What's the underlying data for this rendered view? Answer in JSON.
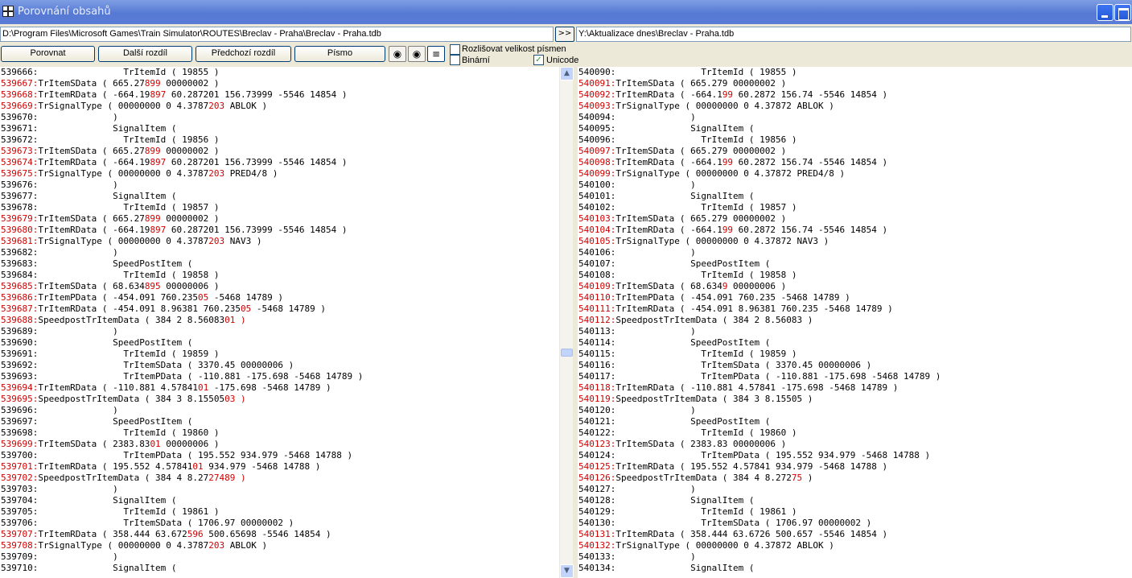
{
  "window": {
    "title": "Porovnání obsahů"
  },
  "paths": {
    "left": "D:\\Program Files\\Microsoft Games\\Train Simulator\\ROUTES\\Breclav - Praha\\Breclav - Praha.tdb",
    "right": "Y:\\Aktualizace dnes\\Breclav - Praha.tdb",
    "swap_label": ">>"
  },
  "toolbar": {
    "compare": "Porovnat",
    "next_diff": "Další rozdíl",
    "prev_diff": "Předchozí rozdíl",
    "font": "Písmo",
    "case_sensitive": {
      "label": "Rozlišovat velikost písmen",
      "checked": false
    },
    "binary": {
      "label": "Binární",
      "checked": false
    },
    "unicode": {
      "label": "Unicode",
      "checked": true
    }
  },
  "left_lines": [
    {
      "n": "539666:",
      "pre": "                TrItemId ( 19855 )",
      "d": "",
      "post": ""
    },
    {
      "n": "539667:",
      "dn": true,
      "pre": "TrItemSData ( 665.27",
      "d": "899",
      "post": " 00000002 )"
    },
    {
      "n": "539668:",
      "dn": true,
      "pre": "TrItemRData ( -664.19",
      "d": "897",
      "post": " 60.287201 156.73999 -5546 14854 )"
    },
    {
      "n": "539669:",
      "dn": true,
      "pre": "TrSignalType ( 00000000 0 4.3787",
      "d": "203",
      "post": " ABLOK )"
    },
    {
      "n": "539670:",
      "pre": "              )",
      "d": "",
      "post": ""
    },
    {
      "n": "539671:",
      "pre": "              SignalItem (",
      "d": "",
      "post": ""
    },
    {
      "n": "539672:",
      "pre": "                TrItemId ( 19856 )",
      "d": "",
      "post": ""
    },
    {
      "n": "539673:",
      "dn": true,
      "pre": "TrItemSData ( 665.27",
      "d": "899",
      "post": " 00000002 )"
    },
    {
      "n": "539674:",
      "dn": true,
      "pre": "TrItemRData ( -664.19",
      "d": "897",
      "post": " 60.287201 156.73999 -5546 14854 )"
    },
    {
      "n": "539675:",
      "dn": true,
      "pre": "TrSignalType ( 00000000 0 4.3787",
      "d": "203",
      "post": " PRED4/8 )"
    },
    {
      "n": "539676:",
      "pre": "              )",
      "d": "",
      "post": ""
    },
    {
      "n": "539677:",
      "pre": "              SignalItem (",
      "d": "",
      "post": ""
    },
    {
      "n": "539678:",
      "pre": "                TrItemId ( 19857 )",
      "d": "",
      "post": ""
    },
    {
      "n": "539679:",
      "dn": true,
      "pre": "TrItemSData ( 665.27",
      "d": "899",
      "post": " 00000002 )"
    },
    {
      "n": "539680:",
      "dn": true,
      "pre": "TrItemRData ( -664.19",
      "d": "897",
      "post": " 60.287201 156.73999 -5546 14854 )"
    },
    {
      "n": "539681:",
      "dn": true,
      "pre": "TrSignalType ( 00000000 0 4.3787",
      "d": "203",
      "post": " NAV3 )"
    },
    {
      "n": "539682:",
      "pre": "              )",
      "d": "",
      "post": ""
    },
    {
      "n": "539683:",
      "pre": "              SpeedPostItem (",
      "d": "",
      "post": ""
    },
    {
      "n": "539684:",
      "pre": "                TrItemId ( 19858 )",
      "d": "",
      "post": ""
    },
    {
      "n": "539685:",
      "dn": true,
      "pre": "TrItemSData ( 68.634",
      "d": "895",
      "post": " 00000006 )"
    },
    {
      "n": "539686:",
      "dn": true,
      "pre": "TrItemPData ( -454.091 760.235",
      "d": "05",
      "post": " -5468 14789 )"
    },
    {
      "n": "539687:",
      "dn": true,
      "pre": "TrItemRData ( -454.091 8.96381 760.235",
      "d": "05",
      "post": " -5468 14789 )"
    },
    {
      "n": "539688:",
      "dn": true,
      "pre": "SpeedpostTrItemData ( 384 2 8.56083",
      "d": "01 )",
      "post": ""
    },
    {
      "n": "539689:",
      "pre": "              )",
      "d": "",
      "post": ""
    },
    {
      "n": "539690:",
      "pre": "              SpeedPostItem (",
      "d": "",
      "post": ""
    },
    {
      "n": "539691:",
      "pre": "                TrItemId ( 19859 )",
      "d": "",
      "post": ""
    },
    {
      "n": "539692:",
      "pre": "                TrItemSData ( 3370.45 00000006 )",
      "d": "",
      "post": ""
    },
    {
      "n": "539693:",
      "pre": "                TrItemPData ( -110.881 -175.698 -5468 14789 )",
      "d": "",
      "post": ""
    },
    {
      "n": "539694:",
      "dn": true,
      "pre": "TrItemRData ( -110.881 4.57841",
      "d": "01",
      "post": " -175.698 -5468 14789 )"
    },
    {
      "n": "539695:",
      "dn": true,
      "pre": "SpeedpostTrItemData ( 384 3 8.15505",
      "d": "03 )",
      "post": ""
    },
    {
      "n": "539696:",
      "pre": "              )",
      "d": "",
      "post": ""
    },
    {
      "n": "539697:",
      "pre": "              SpeedPostItem (",
      "d": "",
      "post": ""
    },
    {
      "n": "539698:",
      "pre": "                TrItemId ( 19860 )",
      "d": "",
      "post": ""
    },
    {
      "n": "539699:",
      "dn": true,
      "pre": "TrItemSData ( 2383.83",
      "d": "01",
      "post": " 00000006 )"
    },
    {
      "n": "539700:",
      "pre": "                TrItemPData ( 195.552 934.979 -5468 14788 )",
      "d": "",
      "post": ""
    },
    {
      "n": "539701:",
      "dn": true,
      "pre": "TrItemRData ( 195.552 4.57841",
      "d": "01",
      "post": " 934.979 -5468 14788 )"
    },
    {
      "n": "539702:",
      "dn": true,
      "pre": "SpeedpostTrItemData ( 384 4 8.27",
      "d": "27489 )",
      "post": ""
    },
    {
      "n": "539703:",
      "pre": "              )",
      "d": "",
      "post": ""
    },
    {
      "n": "539704:",
      "pre": "              SignalItem (",
      "d": "",
      "post": ""
    },
    {
      "n": "539705:",
      "pre": "                TrItemId ( 19861 )",
      "d": "",
      "post": ""
    },
    {
      "n": "539706:",
      "pre": "                TrItemSData ( 1706.97 00000002 )",
      "d": "",
      "post": ""
    },
    {
      "n": "539707:",
      "dn": true,
      "pre": "TrItemRData ( 358.444 63.672",
      "d": "596",
      "post": " 500.65698 -5546 14854 )"
    },
    {
      "n": "539708:",
      "dn": true,
      "pre": "TrSignalType ( 00000000 0 4.3787",
      "d": "203",
      "post": " ABLOK )"
    },
    {
      "n": "539709:",
      "pre": "              )",
      "d": "",
      "post": ""
    },
    {
      "n": "539710:",
      "pre": "              SignalItem (",
      "d": "",
      "post": ""
    }
  ],
  "right_lines": [
    {
      "n": "540090:",
      "pre": "                TrItemId ( 19855 )",
      "d": "",
      "post": ""
    },
    {
      "n": "540091:",
      "dn": true,
      "pre": "TrItemSData ( 665.279 00000002 )",
      "d": "",
      "post": ""
    },
    {
      "n": "540092:",
      "dn": true,
      "pre": "TrItemRData ( -664.1",
      "d": "99",
      "post": " 60.2872 156.74 -5546 14854 )"
    },
    {
      "n": "540093:",
      "dn": true,
      "pre": "TrSignalType ( 00000000 0 4.37872 ABLOK )",
      "d": "",
      "post": ""
    },
    {
      "n": "540094:",
      "pre": "              )",
      "d": "",
      "post": ""
    },
    {
      "n": "540095:",
      "pre": "              SignalItem (",
      "d": "",
      "post": ""
    },
    {
      "n": "540096:",
      "pre": "                TrItemId ( 19856 )",
      "d": "",
      "post": ""
    },
    {
      "n": "540097:",
      "dn": true,
      "pre": "TrItemSData ( 665.279 00000002 )",
      "d": "",
      "post": ""
    },
    {
      "n": "540098:",
      "dn": true,
      "pre": "TrItemRData ( -664.1",
      "d": "99",
      "post": " 60.2872 156.74 -5546 14854 )"
    },
    {
      "n": "540099:",
      "dn": true,
      "pre": "TrSignalType ( 00000000 0 4.37872 PRED4/8 )",
      "d": "",
      "post": ""
    },
    {
      "n": "540100:",
      "pre": "              )",
      "d": "",
      "post": ""
    },
    {
      "n": "540101:",
      "pre": "              SignalItem (",
      "d": "",
      "post": ""
    },
    {
      "n": "540102:",
      "pre": "                TrItemId ( 19857 )",
      "d": "",
      "post": ""
    },
    {
      "n": "540103:",
      "dn": true,
      "pre": "TrItemSData ( 665.279 00000002 )",
      "d": "",
      "post": ""
    },
    {
      "n": "540104:",
      "dn": true,
      "pre": "TrItemRData ( -664.1",
      "d": "99",
      "post": " 60.2872 156.74 -5546 14854 )"
    },
    {
      "n": "540105:",
      "dn": true,
      "pre": "TrSignalType ( 00000000 0 4.37872 NAV3 )",
      "d": "",
      "post": ""
    },
    {
      "n": "540106:",
      "pre": "              )",
      "d": "",
      "post": ""
    },
    {
      "n": "540107:",
      "pre": "              SpeedPostItem (",
      "d": "",
      "post": ""
    },
    {
      "n": "540108:",
      "pre": "                TrItemId ( 19858 )",
      "d": "",
      "post": ""
    },
    {
      "n": "540109:",
      "dn": true,
      "pre": "TrItemSData ( 68.634",
      "d": "9",
      "post": " 00000006 )"
    },
    {
      "n": "540110:",
      "dn": true,
      "pre": "TrItemPData ( -454.091 760.235 -5468 14789 )",
      "d": "",
      "post": ""
    },
    {
      "n": "540111:",
      "dn": true,
      "pre": "TrItemRData ( -454.091 8.96381 760.235 -5468 14789 )",
      "d": "",
      "post": ""
    },
    {
      "n": "540112:",
      "dn": true,
      "pre": "SpeedpostTrItemData ( 384 2 8.56083 )",
      "d": "",
      "post": ""
    },
    {
      "n": "540113:",
      "pre": "              )",
      "d": "",
      "post": ""
    },
    {
      "n": "540114:",
      "pre": "              SpeedPostItem (",
      "d": "",
      "post": ""
    },
    {
      "n": "540115:",
      "pre": "                TrItemId ( 19859 )",
      "d": "",
      "post": ""
    },
    {
      "n": "540116:",
      "pre": "                TrItemSData ( 3370.45 00000006 )",
      "d": "",
      "post": ""
    },
    {
      "n": "540117:",
      "pre": "                TrItemPData ( -110.881 -175.698 -5468 14789 )",
      "d": "",
      "post": ""
    },
    {
      "n": "540118:",
      "dn": true,
      "pre": "TrItemRData ( -110.881 4.57841 -175.698 -5468 14789 )",
      "d": "",
      "post": ""
    },
    {
      "n": "540119:",
      "dn": true,
      "pre": "SpeedpostTrItemData ( 384 3 8.15505 )",
      "d": "",
      "post": ""
    },
    {
      "n": "540120:",
      "pre": "              )",
      "d": "",
      "post": ""
    },
    {
      "n": "540121:",
      "pre": "              SpeedPostItem (",
      "d": "",
      "post": ""
    },
    {
      "n": "540122:",
      "pre": "                TrItemId ( 19860 )",
      "d": "",
      "post": ""
    },
    {
      "n": "540123:",
      "dn": true,
      "pre": "TrItemSData ( 2383.83 00000006 )",
      "d": "",
      "post": ""
    },
    {
      "n": "540124:",
      "pre": "                TrItemPData ( 195.552 934.979 -5468 14788 )",
      "d": "",
      "post": ""
    },
    {
      "n": "540125:",
      "dn": true,
      "pre": "TrItemRData ( 195.552 4.57841 934.979 -5468 14788 )",
      "d": "",
      "post": ""
    },
    {
      "n": "540126:",
      "dn": true,
      "pre": "SpeedpostTrItemData ( 384 4 8.272",
      "d": "75",
      "post": " )"
    },
    {
      "n": "540127:",
      "pre": "              )",
      "d": "",
      "post": ""
    },
    {
      "n": "540128:",
      "pre": "              SignalItem (",
      "d": "",
      "post": ""
    },
    {
      "n": "540129:",
      "pre": "                TrItemId ( 19861 )",
      "d": "",
      "post": ""
    },
    {
      "n": "540130:",
      "pre": "                TrItemSData ( 1706.97 00000002 )",
      "d": "",
      "post": ""
    },
    {
      "n": "540131:",
      "dn": true,
      "pre": "TrItemRData ( 358.444 63.6726 500.657 -5546 14854 )",
      "d": "",
      "post": ""
    },
    {
      "n": "540132:",
      "dn": true,
      "pre": "TrSignalType ( 00000000 0 4.37872 ABLOK )",
      "d": "",
      "post": ""
    },
    {
      "n": "540133:",
      "pre": "              )",
      "d": "",
      "post": ""
    },
    {
      "n": "540134:",
      "pre": "              SignalItem (",
      "d": "",
      "post": ""
    }
  ]
}
